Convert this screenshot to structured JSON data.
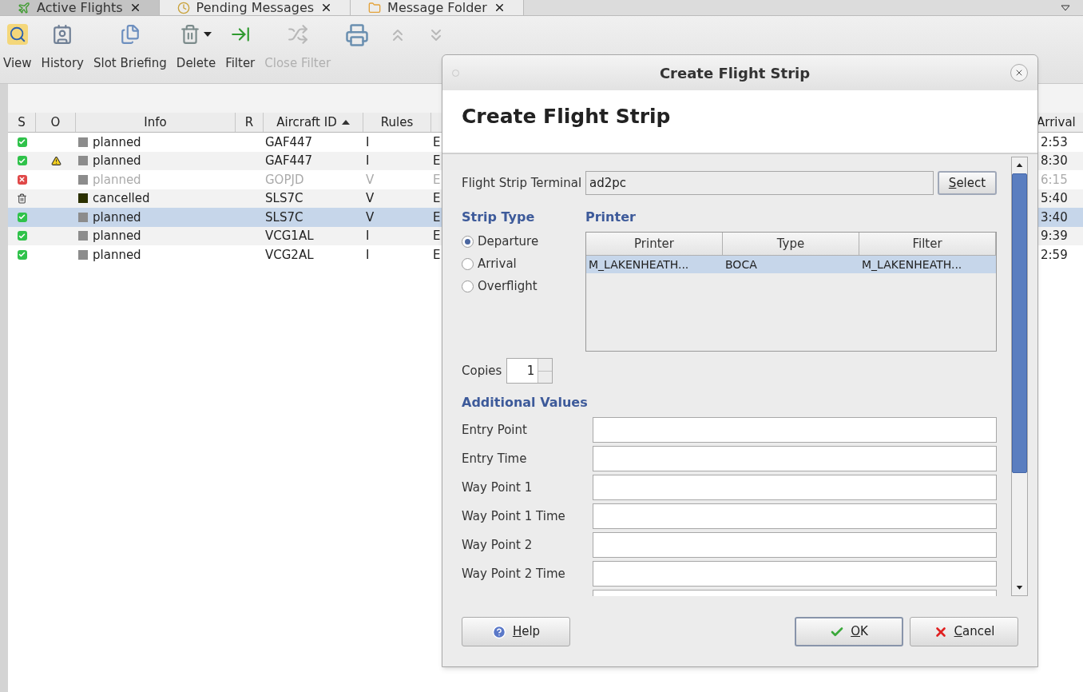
{
  "tabs": [
    {
      "label": "Active Flights",
      "selected": true
    },
    {
      "label": "Pending Messages",
      "selected": false
    },
    {
      "label": "Message Folder",
      "selected": false
    }
  ],
  "toolbar": [
    {
      "label": "View",
      "kind": "view",
      "disabled": false
    },
    {
      "label": "History",
      "kind": "history",
      "disabled": false
    },
    {
      "label": "Slot Briefing",
      "kind": "briefing",
      "disabled": false
    },
    {
      "label": "Delete",
      "kind": "delete",
      "disabled": false
    },
    {
      "label": "Filter",
      "kind": "filter",
      "disabled": false
    },
    {
      "label": "Close Filter",
      "kind": "close_filter",
      "disabled": true
    }
  ],
  "toolbar_icons": [
    {
      "kind": "print",
      "disabled": false
    },
    {
      "kind": "up",
      "disabled": true
    },
    {
      "kind": "down",
      "disabled": true
    }
  ],
  "flights": {
    "columns": [
      {
        "label": "S",
        "sorted": false
      },
      {
        "label": "O",
        "sorted": false
      },
      {
        "label": "Info",
        "sorted": false
      },
      {
        "label": "R",
        "sorted": false
      },
      {
        "label": "Aircraft ID",
        "sorted": true
      },
      {
        "label": "Rules",
        "sorted": false
      }
    ],
    "arrival_header": "Arrival",
    "rows": [
      {
        "kind": "ok",
        "warning": false,
        "info": "planned",
        "color": "#8c8c8c",
        "aircraft_id": "GAF447",
        "rules": "I",
        "column_7": "E",
        "arrival": "2:53",
        "disabled": false,
        "selected": false
      },
      {
        "kind": "ok",
        "warning": true,
        "info": "planned",
        "color": "#8c8c8c",
        "aircraft_id": "GAF447",
        "rules": "I",
        "column_7": "E",
        "arrival": "8:30",
        "disabled": false,
        "selected": false
      },
      {
        "kind": "error",
        "warning": false,
        "info": "planned",
        "color": "#8c8c8c",
        "aircraft_id": "GOPJD",
        "rules": "V",
        "column_7": "E",
        "arrival": "6:15",
        "disabled": true,
        "selected": false
      },
      {
        "kind": "deleted",
        "warning": false,
        "info": "cancelled",
        "color": "#2b3000",
        "aircraft_id": "SLS7C",
        "rules": "V",
        "column_7": "E",
        "arrival": "5:40",
        "disabled": false,
        "selected": false
      },
      {
        "kind": "ok",
        "warning": false,
        "info": "planned",
        "color": "#8c8c8c",
        "aircraft_id": "SLS7C",
        "rules": "V",
        "column_7": "E",
        "arrival": "3:40",
        "disabled": false,
        "selected": true
      },
      {
        "kind": "ok",
        "warning": false,
        "info": "planned",
        "color": "#8c8c8c",
        "aircraft_id": "VCG1AL",
        "rules": "I",
        "column_7": "E",
        "arrival": "9:39",
        "disabled": false,
        "selected": false
      },
      {
        "kind": "ok",
        "warning": false,
        "info": "planned",
        "color": "#8c8c8c",
        "aircraft_id": "VCG2AL",
        "rules": "I",
        "column_7": "E",
        "arrival": "2:59",
        "disabled": false,
        "selected": false
      }
    ]
  },
  "dialog": {
    "title": "Create Flight Strip",
    "heading": "Create Flight Strip",
    "terminal": {
      "label": "Flight Strip Terminal",
      "value": "ad2pc",
      "button": "Select"
    },
    "strip_type": {
      "heading": "Strip Type",
      "options": [
        {
          "label": "Departure",
          "selected": true
        },
        {
          "label": "Arrival",
          "selected": false
        },
        {
          "label": "Overflight",
          "selected": false
        }
      ]
    },
    "printer": {
      "heading": "Printer",
      "columns": [
        "Printer",
        "Type",
        "Filter"
      ],
      "rows": [
        {
          "cells": [
            "M_LAKENHEATH...",
            "BOCA",
            "M_LAKENHEATH..."
          ],
          "selected": true
        }
      ]
    },
    "copies": {
      "label": "Copies",
      "value": "1"
    },
    "additional": {
      "heading": "Additional Values",
      "fields": [
        {
          "label": "Entry Point"
        },
        {
          "label": "Entry Time"
        },
        {
          "label": "Way Point 1"
        },
        {
          "label": "Way Point 1 Time"
        },
        {
          "label": "Way Point 2"
        },
        {
          "label": "Way Point 2 Time"
        }
      ]
    },
    "buttons": [
      {
        "label": "Help",
        "kind": "help",
        "default": false
      },
      {
        "label": "OK",
        "kind": "ok",
        "default": true
      },
      {
        "label": "Cancel",
        "kind": "cancel",
        "default": false
      }
    ]
  }
}
